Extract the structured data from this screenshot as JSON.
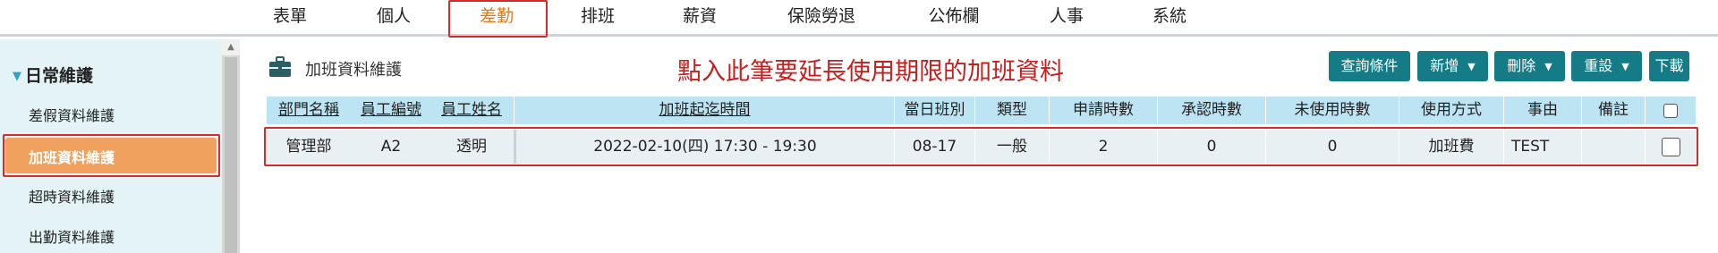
{
  "nav": {
    "items": [
      "表單",
      "個人",
      "差勤",
      "排班",
      "薪資",
      "保險勞退",
      "公佈欄",
      "人事",
      "系統"
    ],
    "active_index": 2
  },
  "sidebar": {
    "section_title": "日常維護",
    "items": [
      "差假資料維護",
      "加班資料維護",
      "超時資料維護",
      "出勤資料維護"
    ],
    "active_index": 1
  },
  "main": {
    "title": "加班資料維護",
    "annotation": "點入此筆要延長使用期限的加班資料",
    "buttons": {
      "query": "查詢條件",
      "add": "新增",
      "delete": "刪除",
      "reset": "重設",
      "download": "下載"
    }
  },
  "table": {
    "headers": [
      "部門名稱",
      "員工編號",
      "員工姓名",
      "加班起迄時間",
      "當日班別",
      "類型",
      "申請時數",
      "承認時數",
      "未使用時數",
      "使用方式",
      "事由",
      "備註"
    ],
    "rows": [
      {
        "dept": "管理部",
        "emp_no": "A2",
        "emp_name": "透明",
        "time_range": "2022-02-10(四) 17:30 - 19:30",
        "shift": "08-17",
        "type": "一般",
        "applied_hours": "2",
        "approved_hours": "0",
        "unused_hours": "0",
        "usage": "加班費",
        "reason": "TEST",
        "note": ""
      }
    ]
  },
  "colors": {
    "accent": "#157b86",
    "active_nav": "#e07b1f",
    "active_sidebar": "#f0a15d",
    "highlight_border": "#d62b2b",
    "annotation": "#c42020"
  }
}
